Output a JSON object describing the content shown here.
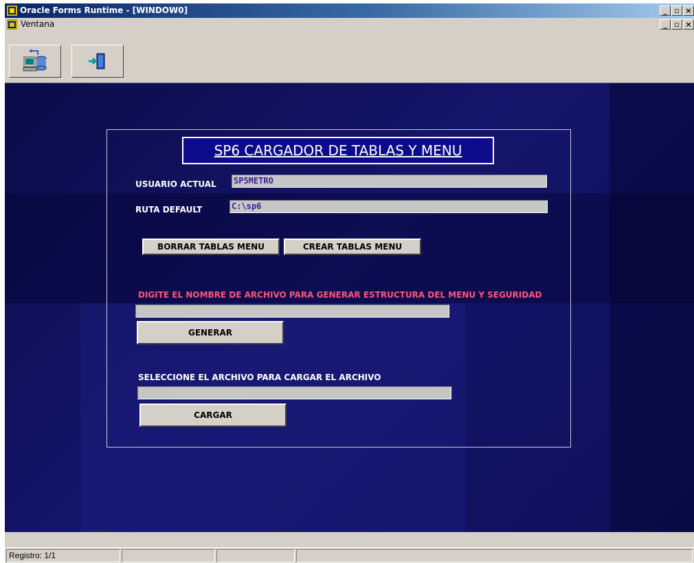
{
  "window": {
    "title": "Oracle Forms Runtime - [WINDOW0]",
    "app_icon": "oracle-forms-icon",
    "controls": [
      "_",
      "̅ ",
      "×"
    ]
  },
  "menubar": {
    "label": "Ventana"
  },
  "toolbar": {
    "buttons": [
      "database-connect-icon",
      "exit-door-icon"
    ]
  },
  "form": {
    "title": "SP6 CARGADOR DE TABLAS Y MENU",
    "usuario_label": "USUARIO ACTUAL",
    "usuario_value": "SP5METRO",
    "ruta_label": "RUTA DEFAULT",
    "ruta_value": "C:\\sp6",
    "borrar_button": "BORRAR TABLAS MENU",
    "crear_button": "CREAR TABLAS MENU",
    "generar_prompt": "DIGITE EL NOMBRE DE ARCHIVO PARA GENERAR ESTRUCTURA DEL MENU Y SEGURIDAD",
    "generar_value": "",
    "generar_button": "GENERAR",
    "cargar_prompt": "SELECCIONE EL ARCHIVO PARA CARGAR EL ARCHIVO",
    "cargar_value": "",
    "cargar_button": "CARGAR"
  },
  "statusbar": {
    "record": "Registro: 1/1"
  },
  "colors": {
    "canvas": "#0f0f5a",
    "headline_bg": "#0b0b8c",
    "prompt_red": "#ff5577",
    "field_text": "#3a1aa0"
  }
}
